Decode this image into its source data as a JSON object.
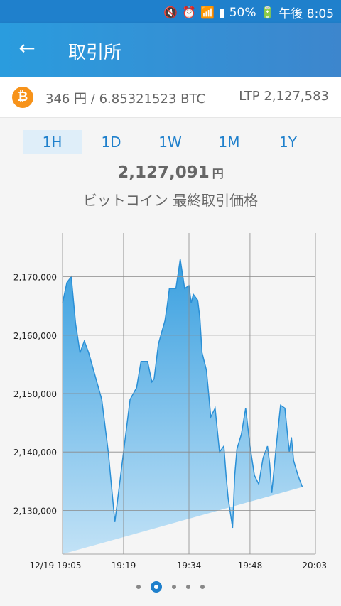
{
  "status_bar": {
    "battery": "50%",
    "time": "午後 8:05"
  },
  "app_bar": {
    "title": "取引所"
  },
  "info": {
    "balance": "346 円 / 6.85321523 BTC",
    "ltp": "LTP 2,127,583",
    "coin_symbol": "₿"
  },
  "tabs": [
    {
      "label": "1H",
      "selected": true
    },
    {
      "label": "1D",
      "selected": false
    },
    {
      "label": "1W",
      "selected": false
    },
    {
      "label": "1M",
      "selected": false
    },
    {
      "label": "1Y",
      "selected": false
    }
  ],
  "price": {
    "value": "2,127,091",
    "unit": "円",
    "label": "ビットコイン 最終取引価格"
  },
  "colors": {
    "accent": "#1f80cc",
    "btc": "#f7931a",
    "fill_top": "#3aa0e0",
    "fill_bottom": "#bfe0f5"
  },
  "chart_data": {
    "type": "area",
    "y_ticks": [
      "2,170,000",
      "2,160,000",
      "2,150,000",
      "2,140,000",
      "2,130,000"
    ],
    "y_tick_values": [
      2170000,
      2160000,
      2150000,
      2140000,
      2130000
    ],
    "x_ticks": [
      "12/19 19:05",
      "19:19",
      "19:34",
      "19:48",
      "20:03"
    ],
    "x_tick_minutes": [
      0,
      14,
      29,
      43,
      58
    ],
    "ylim": [
      2122500,
      2177500
    ],
    "xlim": [
      0,
      58
    ],
    "grid": true,
    "x": [
      0,
      1,
      1.5,
      2,
      3,
      4,
      5,
      6,
      9,
      10.5,
      12,
      14,
      15.5,
      17,
      18,
      19.5,
      20.5,
      21,
      22,
      23.5,
      24,
      24.5,
      26,
      27,
      28,
      29,
      29.5,
      30,
      31,
      31.5,
      32,
      33,
      34,
      35,
      36,
      37,
      37.5,
      38,
      39,
      39.5,
      40,
      41,
      42,
      43,
      44,
      45,
      46,
      47,
      47.5,
      48,
      49,
      50,
      51,
      52,
      52.5,
      53,
      54,
      55,
      56,
      57,
      58
    ],
    "y": [
      2165500,
      2169000,
      2169500,
      2170000,
      2162000,
      2157000,
      2159000,
      2157000,
      2149000,
      2140000,
      2128000,
      2140000,
      2149000,
      2151000,
      2155500,
      2155500,
      2152000,
      2152500,
      2158500,
      2162500,
      2165000,
      2168000,
      2168000,
      2173000,
      2168000,
      2168500,
      2165500,
      2167000,
      2166000,
      2163000,
      2157000,
      2154000,
      2146000,
      2147500,
      2140000,
      2141000,
      2136000,
      2132000,
      2127000,
      2136000,
      2140500,
      2143000,
      2147500,
      2141000,
      2136000,
      2134500,
      2139000,
      2141000,
      2138000,
      2133000,
      2141000,
      2148000,
      2147500,
      2140000,
      2142500,
      2138500,
      2136000,
      2134000
    ]
  },
  "pager": {
    "count": 5,
    "active": 1
  }
}
